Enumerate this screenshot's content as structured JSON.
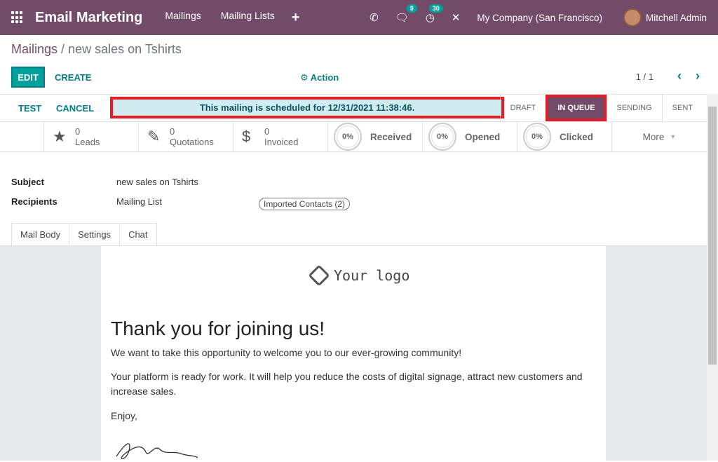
{
  "navbar": {
    "app_title": "Email Marketing",
    "menu": [
      "Mailings",
      "Mailing Lists"
    ],
    "plus": "+",
    "chat_badge": "9",
    "activity_badge": "30",
    "company": "My Company (San Francisco)",
    "user": "Mitchell Admin"
  },
  "breadcrumb": {
    "parent": "Mailings",
    "separator": "/",
    "current": "new sales on Tshirts"
  },
  "control": {
    "edit": "EDIT",
    "create": "CREATE",
    "action": "Action",
    "pager": "1 / 1"
  },
  "statusbar": {
    "test": "TEST",
    "cancel": "CANCEL",
    "alert": "This mailing is scheduled for 12/31/2021 11:38:46.",
    "stages": [
      "DRAFT",
      "IN QUEUE",
      "SENDING",
      "SENT"
    ]
  },
  "buttonbox": {
    "leads": {
      "value": "0",
      "label": "Leads",
      "icon": "star-icon"
    },
    "quotations": {
      "value": "0",
      "label": "Quotations",
      "icon": "edit-icon"
    },
    "invoiced": {
      "value": "0",
      "label": "Invoiced",
      "icon": "dollar-icon"
    },
    "received": {
      "percent": "0%",
      "label": "Received"
    },
    "opened": {
      "percent": "0%",
      "label": "Opened"
    },
    "clicked": {
      "percent": "0%",
      "label": "Clicked"
    },
    "more": "More"
  },
  "form": {
    "subject_label": "Subject",
    "subject_value": "new sales on Tshirts",
    "recipients_label": "Recipients",
    "recipients_value": "Mailing List",
    "recipients_tag": "Imported Contacts (2)"
  },
  "tabs": [
    "Mail Body",
    "Settings",
    "Chat"
  ],
  "mail": {
    "logo_text": "Your logo",
    "heading": "Thank you for joining us!",
    "p1": "We want to take this opportunity to welcome you to our ever-growing community!",
    "p2": "Your platform is ready for work. It will help you reduce the costs of digital signage, attract new customers and increase sales.",
    "p3": "Enjoy,"
  },
  "colors": {
    "brand": "#714b67",
    "accent": "#00a09d",
    "highlight": "#e31d25",
    "alert_bg": "#d1ecf1"
  }
}
